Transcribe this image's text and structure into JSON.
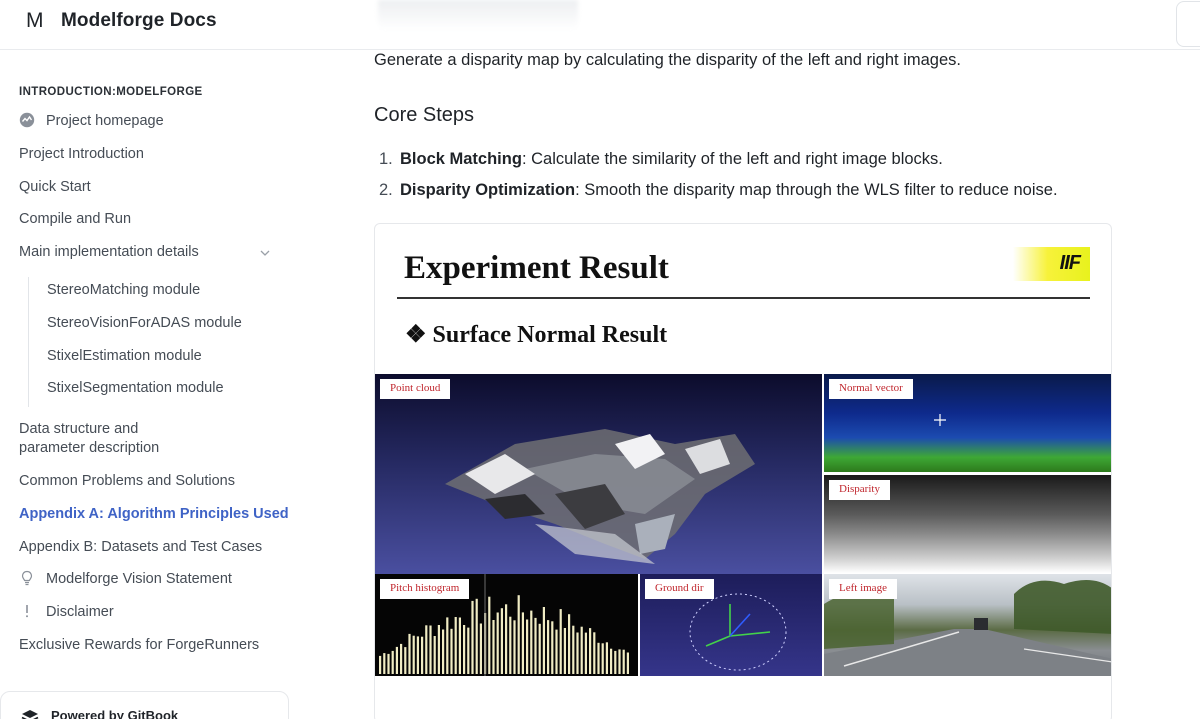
{
  "header": {
    "logo_letter": "M",
    "title": "Modelforge Docs"
  },
  "sidebar": {
    "section_title": "INTRODUCTION:MODELFORGE",
    "items": [
      {
        "label": "Project homepage",
        "icon": "globe-icon"
      },
      {
        "label": "Project Introduction"
      },
      {
        "label": "Quick Start"
      },
      {
        "label": "Compile and Run"
      },
      {
        "label": "Main implementation details",
        "icon": "chevron-down-icon"
      },
      {
        "label": "Data structure and"
      },
      {
        "label": "parameter description"
      },
      {
        "label": "Common Problems and Solutions"
      },
      {
        "label": "Appendix A: Algorithm Principles Used",
        "active": true
      },
      {
        "label": "Appendix B: Datasets and Test Cases"
      },
      {
        "label": "Modelforge Vision Statement",
        "icon": "lightbulb-icon"
      },
      {
        "label": "Disclaimer",
        "icon": "exclamation-icon"
      },
      {
        "label": "Exclusive Rewards for ForgeRunners"
      }
    ],
    "sub_items": [
      "StereoMatching module",
      "StereoVisionForADAS module",
      "StixelEstimation module",
      "StixelSegmentation module"
    ],
    "powered_by": "Powered by GitBook"
  },
  "main": {
    "lead": "Generate a disparity map by calculating the disparity of the left and right images.",
    "heading": "Core Steps",
    "steps": [
      {
        "num": "1.",
        "term": "Block Matching",
        "text": ": Calculate the similarity of the left and right image blocks."
      },
      {
        "num": "2.",
        "term": "Disparity Optimization",
        "text": ": Smooth the disparity map through the WLS filter to reduce noise."
      }
    ],
    "figure": {
      "title": "Experiment Result",
      "subtitle": "❖ Surface Normal Result",
      "logo_text": "IIF",
      "panels": {
        "point_cloud": "Point cloud",
        "normal_vector": "Normal vector",
        "disparity": "Disparity",
        "pitch_histogram": "Pitch histogram",
        "ground_dir": "Ground dir",
        "left_image": "Left image"
      }
    }
  },
  "colors": {
    "accent": "#3f63c6",
    "label_red": "#c0262d"
  }
}
